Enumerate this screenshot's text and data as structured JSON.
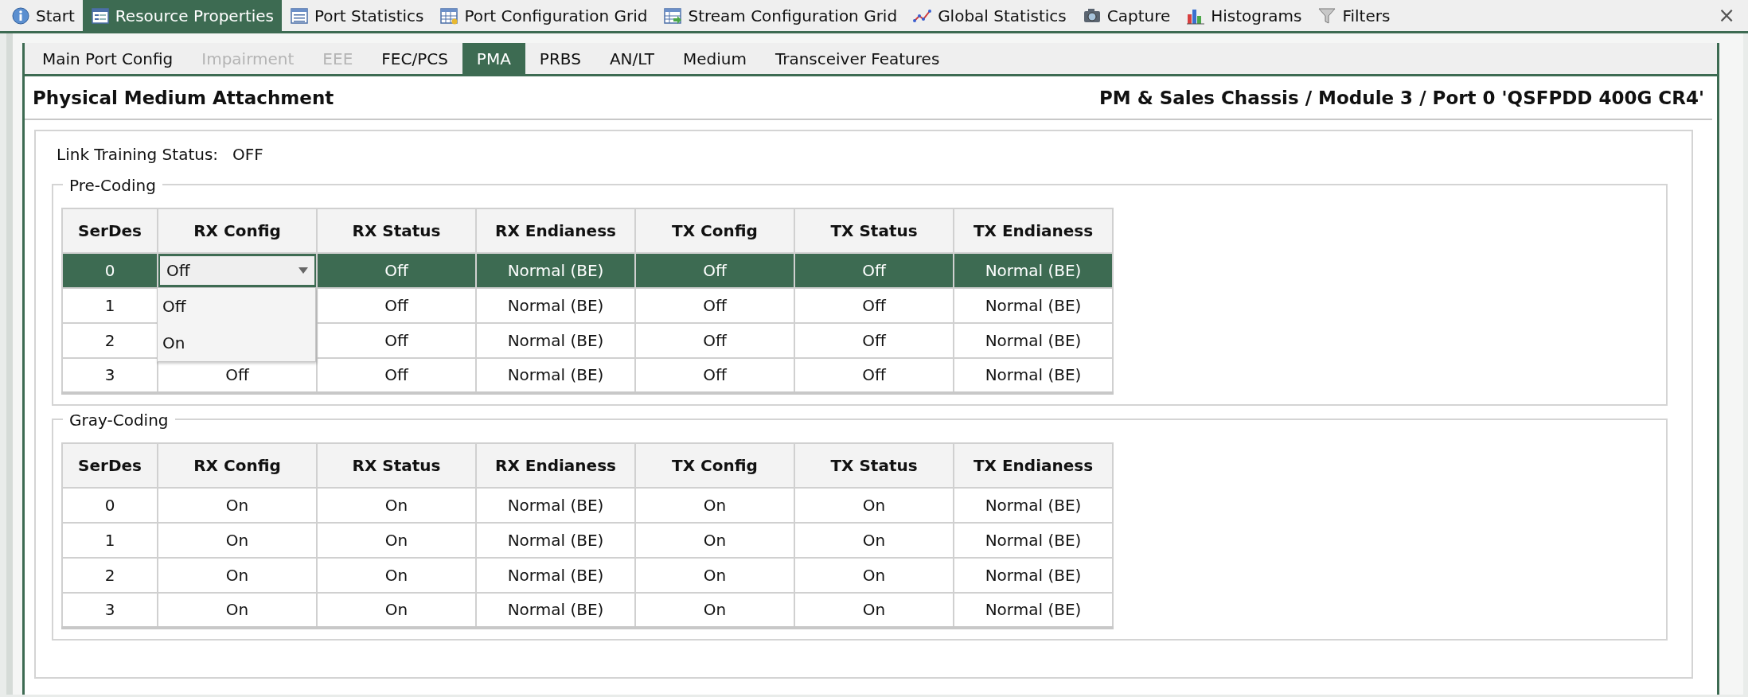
{
  "top_tabs": [
    {
      "label": "Start",
      "selected": false
    },
    {
      "label": "Resource Properties",
      "selected": true
    },
    {
      "label": "Port Statistics",
      "selected": false
    },
    {
      "label": "Port Configuration Grid",
      "selected": false
    },
    {
      "label": "Stream Configuration Grid",
      "selected": false
    },
    {
      "label": "Global Statistics",
      "selected": false
    },
    {
      "label": "Capture",
      "selected": false
    },
    {
      "label": "Histograms",
      "selected": false
    },
    {
      "label": "Filters",
      "selected": false
    }
  ],
  "close_button": "×",
  "sub_tabs": [
    {
      "label": "Main Port Config",
      "selected": false,
      "disabled": false
    },
    {
      "label": "Impairment",
      "selected": false,
      "disabled": true
    },
    {
      "label": "EEE",
      "selected": false,
      "disabled": true
    },
    {
      "label": "FEC/PCS",
      "selected": false,
      "disabled": false
    },
    {
      "label": "PMA",
      "selected": true,
      "disabled": false
    },
    {
      "label": "PRBS",
      "selected": false,
      "disabled": false
    },
    {
      "label": "AN/LT",
      "selected": false,
      "disabled": false
    },
    {
      "label": "Medium",
      "selected": false,
      "disabled": false
    },
    {
      "label": "Transceiver Features",
      "selected": false,
      "disabled": false
    }
  ],
  "header": {
    "title": "Physical Medium Attachment",
    "path": "PM & Sales Chassis / Module 3 / Port 0 'QSFPDD 400G CR4'"
  },
  "link_training": {
    "label": "Link Training Status:",
    "value": "OFF"
  },
  "groups": [
    {
      "title": "Pre-Coding",
      "columns": [
        "SerDes",
        "RX Config",
        "RX Status",
        "RX Endianess",
        "TX Config",
        "TX Status",
        "TX Endianess"
      ],
      "rows": [
        {
          "selected": true,
          "cells": [
            {
              "text": "0"
            },
            {
              "kind": "combo",
              "text": "Off",
              "options": [
                "Off",
                "On"
              ]
            },
            {
              "text": "Off"
            },
            {
              "text": "Normal (BE)"
            },
            {
              "text": "Off"
            },
            {
              "text": "Off"
            },
            {
              "text": "Normal (BE)"
            }
          ]
        },
        {
          "selected": false,
          "cells": [
            {
              "text": "1"
            },
            {
              "kind": "hidden"
            },
            {
              "text": "Off"
            },
            {
              "text": "Normal (BE)"
            },
            {
              "text": "Off"
            },
            {
              "text": "Off"
            },
            {
              "text": "Normal (BE)"
            }
          ]
        },
        {
          "selected": false,
          "cells": [
            {
              "text": "2"
            },
            {
              "kind": "hidden"
            },
            {
              "text": "Off"
            },
            {
              "text": "Normal (BE)"
            },
            {
              "text": "Off"
            },
            {
              "text": "Off"
            },
            {
              "text": "Normal (BE)"
            }
          ]
        },
        {
          "selected": false,
          "cells": [
            {
              "text": "3"
            },
            {
              "text": "Off"
            },
            {
              "text": "Off"
            },
            {
              "text": "Normal (BE)"
            },
            {
              "text": "Off"
            },
            {
              "text": "Off"
            },
            {
              "text": "Normal (BE)"
            }
          ]
        }
      ]
    },
    {
      "title": "Gray-Coding",
      "columns": [
        "SerDes",
        "RX Config",
        "RX Status",
        "RX Endianess",
        "TX Config",
        "TX Status",
        "TX Endianess"
      ],
      "rows": [
        {
          "selected": false,
          "cells": [
            {
              "text": "0"
            },
            {
              "text": "On"
            },
            {
              "text": "On"
            },
            {
              "text": "Normal (BE)"
            },
            {
              "text": "On"
            },
            {
              "text": "On"
            },
            {
              "text": "Normal (BE)"
            }
          ]
        },
        {
          "selected": false,
          "cells": [
            {
              "text": "1"
            },
            {
              "text": "On"
            },
            {
              "text": "On"
            },
            {
              "text": "Normal (BE)"
            },
            {
              "text": "On"
            },
            {
              "text": "On"
            },
            {
              "text": "Normal (BE)"
            }
          ]
        },
        {
          "selected": false,
          "cells": [
            {
              "text": "2"
            },
            {
              "text": "On"
            },
            {
              "text": "On"
            },
            {
              "text": "Normal (BE)"
            },
            {
              "text": "On"
            },
            {
              "text": "On"
            },
            {
              "text": "Normal (BE)"
            }
          ]
        },
        {
          "selected": false,
          "cells": [
            {
              "text": "3"
            },
            {
              "text": "On"
            },
            {
              "text": "On"
            },
            {
              "text": "Normal (BE)"
            },
            {
              "text": "On"
            },
            {
              "text": "On"
            },
            {
              "text": "Normal (BE)"
            }
          ]
        }
      ]
    }
  ]
}
